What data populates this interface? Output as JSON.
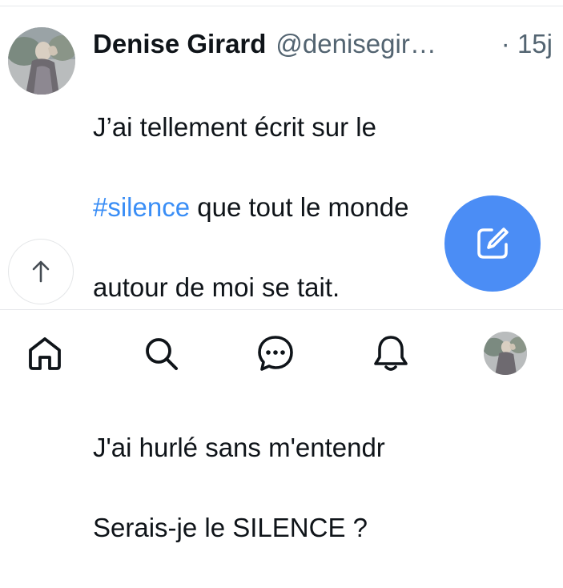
{
  "tweet": {
    "display_name": "Denise Girard",
    "handle": "@denisegir…",
    "time": "· 15j",
    "lines": [
      "J’ai tellement écrit sur le",
      "que tout le monde",
      "autour de moi se tait.",
      "",
      "J'ai hurlé sans m'entendr",
      "Serais-je le SILENCE ?"
    ],
    "hashtag": "#silence"
  },
  "icons": {
    "scroll_top": "arrow-up-icon",
    "compose": "compose-icon",
    "nav": [
      "home-icon",
      "search-icon",
      "messages-icon",
      "notifications-icon",
      "profile-avatar"
    ]
  },
  "colors": {
    "hashtag": "#3a8ef6",
    "fab": "#4b8df5",
    "secondary_text": "#536471"
  }
}
